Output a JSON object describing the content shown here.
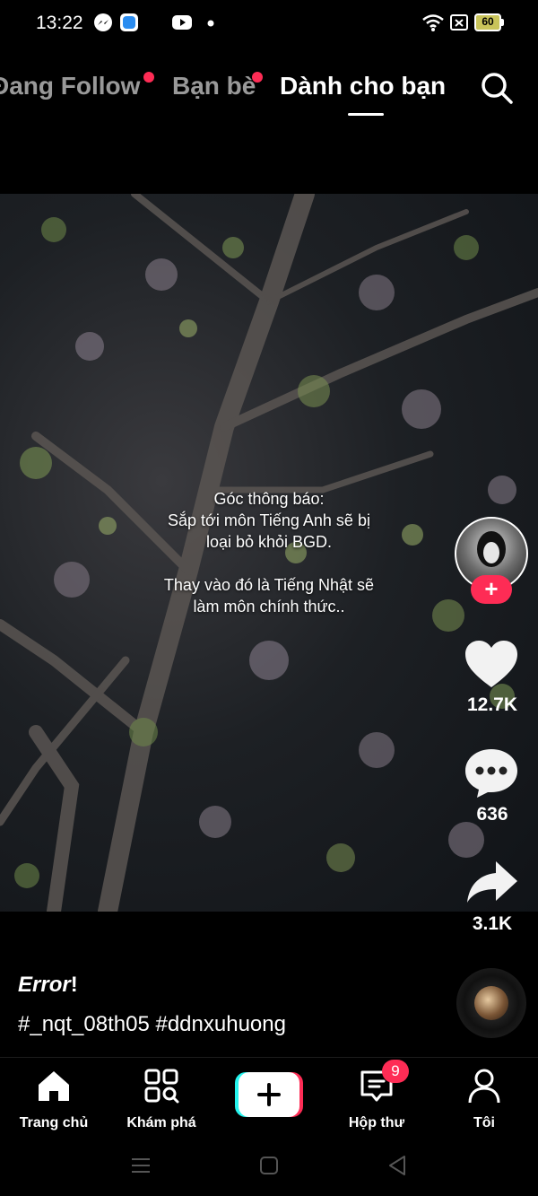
{
  "status_bar": {
    "time": "13:22",
    "battery": "60",
    "icons": [
      "messenger-icon",
      "app-icon",
      "youtube-icon",
      "dot-icon",
      "wifi-icon",
      "sim-icon",
      "battery-icon"
    ]
  },
  "top_tabs": {
    "following": "Đang Follow",
    "friends": "Bạn bè",
    "for_you": "Dành cho bạn",
    "active": "for_you"
  },
  "video": {
    "overlay_lines": [
      "Góc thông báo:",
      "Sắp tới môn Tiếng Anh sẽ bị",
      "loại bỏ khỏi BGD.",
      "",
      "Thay vào đó là Tiếng Nhật sẽ",
      "làm môn chính thức.."
    ]
  },
  "actions": {
    "follow_symbol": "+",
    "likes": "12.7K",
    "comments": "636",
    "shares": "3.1K"
  },
  "caption": {
    "author": "Error",
    "author_suffix": "!",
    "tags": "#_nqt_08th05 #ddnxuhuong"
  },
  "bottom_nav": {
    "home": "Trang chủ",
    "discover": "Khám phá",
    "inbox": "Hộp thư",
    "inbox_badge": "9",
    "profile": "Tôi"
  },
  "colors": {
    "accent": "#fe2c55",
    "create_cyan": "#25f4ee"
  }
}
